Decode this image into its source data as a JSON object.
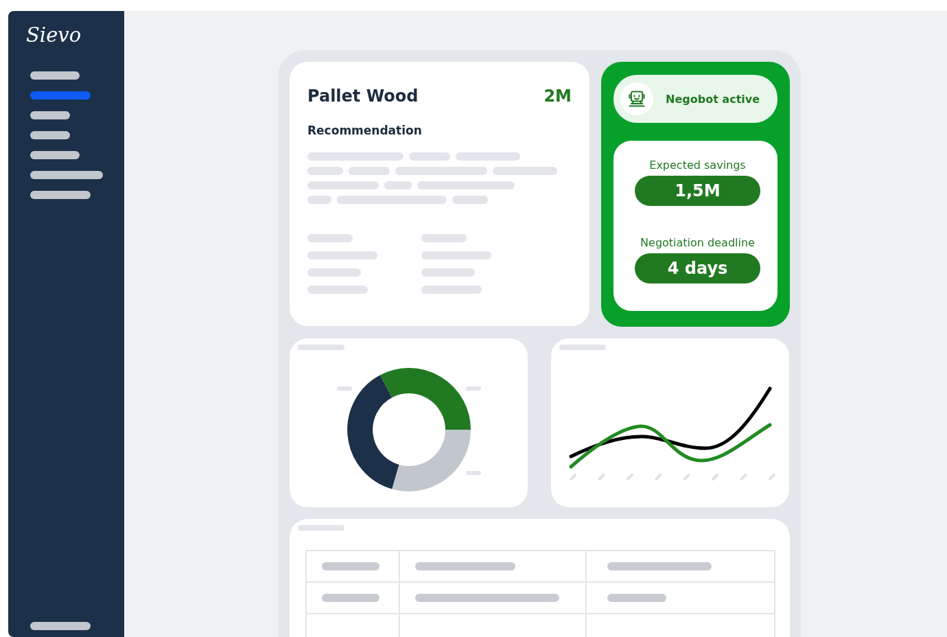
{
  "sidebar": {
    "logo": "Sievo",
    "items": [
      {
        "selected": false
      },
      {
        "selected": true
      },
      {
        "selected": false
      },
      {
        "selected": false
      },
      {
        "selected": false
      },
      {
        "selected": false
      },
      {
        "selected": false
      }
    ]
  },
  "item_card": {
    "title": "Pallet Wood",
    "amount": "2M",
    "section": "Recommendation"
  },
  "negobot": {
    "status": "Negobot active",
    "active": true,
    "metrics": [
      {
        "label": "Expected savings",
        "value": "1,5M"
      },
      {
        "label": "Negotiation deadline",
        "value": "4 days"
      }
    ]
  }
}
